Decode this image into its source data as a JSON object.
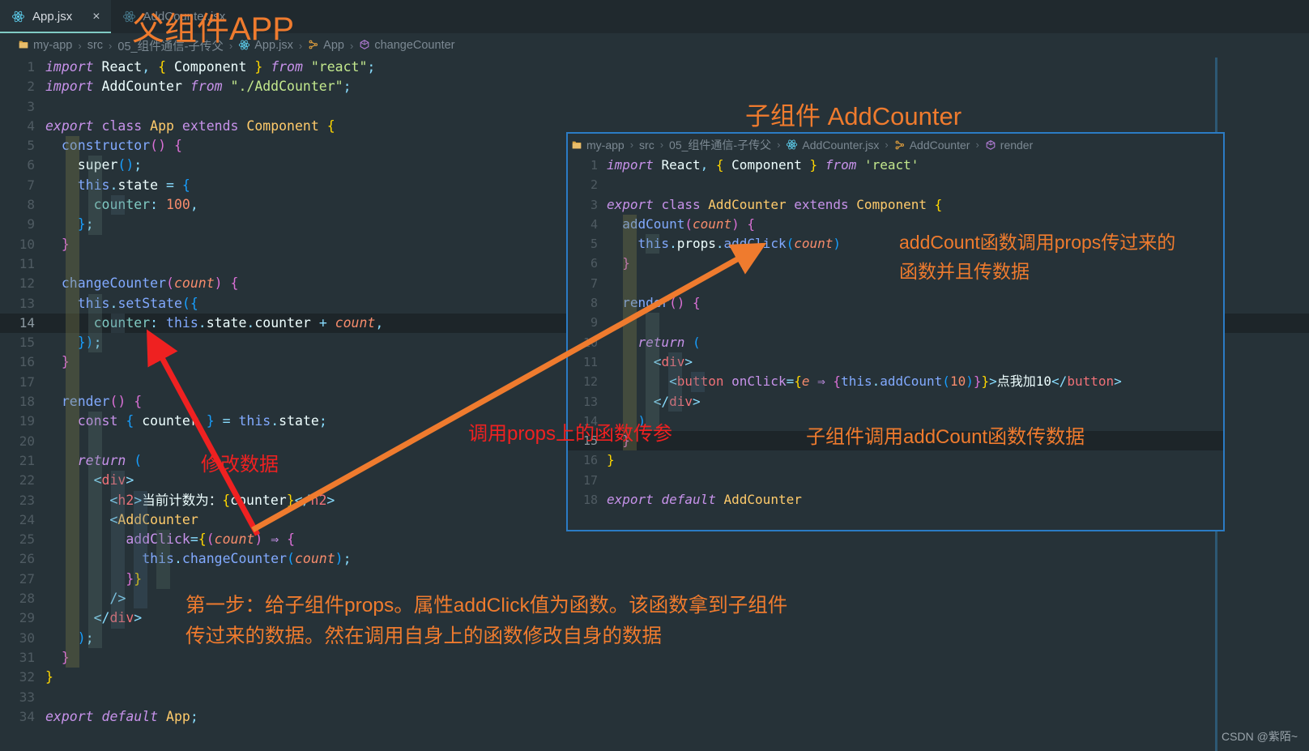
{
  "window": {
    "background": "#263238",
    "accent_teal": "#80cbc4",
    "inset_border": "#2b7bc4",
    "annotation_orange": "#ef7b2e",
    "annotation_red": "#ef2121"
  },
  "tabs": [
    {
      "label": "App.jsx",
      "icon": "react-icon",
      "active": true,
      "close": "×"
    },
    {
      "label": "AddCounter.jsx",
      "icon": "react-icon",
      "active": false,
      "close": ""
    }
  ],
  "breadcrumb": {
    "items": [
      {
        "label": "my-app",
        "icon": "folder-icon"
      },
      {
        "label": "src",
        "icon": ""
      },
      {
        "label": "05_组件通信-子传父",
        "icon": ""
      },
      {
        "label": "App.jsx",
        "icon": "react-icon"
      },
      {
        "label": "App",
        "icon": "class-icon"
      },
      {
        "label": "changeCounter",
        "icon": "method-icon"
      }
    ],
    "separator": "›"
  },
  "main_editor": {
    "lines": [
      {
        "n": 1,
        "guides": 0,
        "html": "<span class=\"kw\">import</span> <span class=\"plain\">React</span><span class=\"punc\">,</span> <span class=\"brkt1\">{</span> <span class=\"plain\">Component</span> <span class=\"brkt1\">}</span> <span class=\"kw\">from</span> <span class=\"str\">\"react\"</span><span class=\"punc\">;</span>"
      },
      {
        "n": 2,
        "guides": 0,
        "html": "<span class=\"kw\">import</span> <span class=\"plain\">AddCounter</span> <span class=\"kw\">from</span> <span class=\"str\">\"./AddCounter\"</span><span class=\"punc\">;</span>"
      },
      {
        "n": 3,
        "guides": 0,
        "html": ""
      },
      {
        "n": 4,
        "guides": 0,
        "html": "<span class=\"kw\">export</span> <span class=\"kw2\">class</span> <span class=\"cls\">App</span> <span class=\"kw2\">extends</span> <span class=\"cls\">Component</span> <span class=\"brkt1\">{</span>"
      },
      {
        "n": 5,
        "guides": 1,
        "html": "  <span class=\"fn\">constructor</span><span class=\"brkt2\">()</span> <span class=\"brkt2\">{</span>"
      },
      {
        "n": 6,
        "guides": 2,
        "html": "    <span class=\"plain\">super</span><span class=\"brkt3\">()</span><span class=\"punc\">;</span>"
      },
      {
        "n": 7,
        "guides": 2,
        "html": "    <span class=\"var\">this</span><span class=\"punc\">.</span><span class=\"plain\">state</span> <span class=\"op\">=</span> <span class=\"brkt3\">{</span>"
      },
      {
        "n": 8,
        "guides": 3,
        "html": "      <span class=\"prop\">counter</span><span class=\"punc\">:</span> <span class=\"num\">100</span><span class=\"punc\">,</span>"
      },
      {
        "n": 9,
        "guides": 2,
        "html": "    <span class=\"brkt3\">}</span><span class=\"punc\">;</span>"
      },
      {
        "n": 10,
        "guides": 1,
        "html": "  <span class=\"brkt2\">}</span>"
      },
      {
        "n": 11,
        "guides": 1,
        "html": ""
      },
      {
        "n": 12,
        "guides": 1,
        "html": "  <span class=\"fn\">changeCounter</span><span class=\"brkt2\">(</span><span class=\"param\">count</span><span class=\"brkt2\">)</span> <span class=\"brkt2\">{</span>"
      },
      {
        "n": 13,
        "guides": 2,
        "html": "    <span class=\"var\">this</span><span class=\"punc\">.</span><span class=\"fn\">setState</span><span class=\"brkt3\">({</span>"
      },
      {
        "n": 14,
        "guides": 3,
        "cursor": true,
        "html": "      <span class=\"prop\">counter</span><span class=\"punc\">:</span> <span class=\"var\">this</span><span class=\"punc\">.</span><span class=\"plain\">state</span><span class=\"punc\">.</span><span class=\"plain\">counter</span> <span class=\"op\">+</span> <span class=\"param\">count</span><span class=\"punc\">,</span>"
      },
      {
        "n": 15,
        "guides": 2,
        "html": "    <span class=\"brkt3\">})</span><span class=\"punc\">;</span>"
      },
      {
        "n": 16,
        "guides": 1,
        "html": "  <span class=\"brkt2\">}</span>"
      },
      {
        "n": 17,
        "guides": 1,
        "html": ""
      },
      {
        "n": 18,
        "guides": 1,
        "html": "  <span class=\"fn\">render</span><span class=\"brkt2\">()</span> <span class=\"brkt2\">{</span>"
      },
      {
        "n": 19,
        "guides": 2,
        "html": "    <span class=\"kw2\">const</span> <span class=\"brkt3\">{</span> <span class=\"plain\">counter</span> <span class=\"brkt3\">}</span> <span class=\"op\">=</span> <span class=\"var\">this</span><span class=\"punc\">.</span><span class=\"plain\">state</span><span class=\"punc\">;</span>"
      },
      {
        "n": 20,
        "guides": 2,
        "html": ""
      },
      {
        "n": 21,
        "guides": 2,
        "html": "    <span class=\"kw\">return</span> <span class=\"brkt3\">(</span>"
      },
      {
        "n": 22,
        "guides": 3,
        "html": "      <span class=\"punc\">&lt;</span><span class=\"tag\">div</span><span class=\"punc\">&gt;</span>"
      },
      {
        "n": 23,
        "guides": 4,
        "html": "        <span class=\"punc\">&lt;</span><span class=\"tag\">h2</span><span class=\"punc\">&gt;</span><span class=\"txt\">当前计数为：</span><span class=\"brkt1\">{</span><span class=\"plain\">counter</span><span class=\"brkt1\">}</span><span class=\"punc\">&lt;/</span><span class=\"tag\">h2</span><span class=\"punc\">&gt;</span>"
      },
      {
        "n": 24,
        "guides": 4,
        "html": "        <span class=\"punc\">&lt;</span><span class=\"cls\">AddCounter</span>"
      },
      {
        "n": 25,
        "guides": 5,
        "html": "          <span class=\"attr\">addClick</span><span class=\"op\">=</span><span class=\"brkt1\">{</span><span class=\"brkt2\">(</span><span class=\"param\">count</span><span class=\"brkt2\">)</span> <span class=\"arrow\">⇒</span> <span class=\"brkt2\">{</span>"
      },
      {
        "n": 26,
        "guides": 5,
        "html": "            <span class=\"var\">this</span><span class=\"punc\">.</span><span class=\"fn\">changeCounter</span><span class=\"brkt3\">(</span><span class=\"param\">count</span><span class=\"brkt3\">)</span><span class=\"punc\">;</span>"
      },
      {
        "n": 27,
        "guides": 5,
        "html": "          <span class=\"brkt2\">}</span><span class=\"brkt1\">}</span>"
      },
      {
        "n": 28,
        "guides": 4,
        "html": "        <span class=\"punc\">/&gt;</span>"
      },
      {
        "n": 29,
        "guides": 3,
        "html": "      <span class=\"punc\">&lt;/</span><span class=\"tag\">div</span><span class=\"punc\">&gt;</span>"
      },
      {
        "n": 30,
        "guides": 2,
        "html": "    <span class=\"brkt3\">)</span><span class=\"punc\">;</span>"
      },
      {
        "n": 31,
        "guides": 1,
        "html": "  <span class=\"brkt2\">}</span>"
      },
      {
        "n": 32,
        "guides": 0,
        "html": "<span class=\"brkt1\">}</span>"
      },
      {
        "n": 33,
        "guides": 0,
        "html": ""
      },
      {
        "n": 34,
        "guides": 0,
        "html": "<span class=\"kw\">export</span> <span class=\"kw\">default</span> <span class=\"cls\">App</span><span class=\"punc\">;</span>"
      }
    ]
  },
  "inset_editor": {
    "breadcrumb": {
      "items": [
        {
          "label": "my-app",
          "icon": "folder-icon"
        },
        {
          "label": "src",
          "icon": ""
        },
        {
          "label": "05_组件通信-子传父",
          "icon": ""
        },
        {
          "label": "AddCounter.jsx",
          "icon": "react-icon"
        },
        {
          "label": "AddCounter",
          "icon": "class-icon"
        },
        {
          "label": "render",
          "icon": "method-icon"
        }
      ],
      "separator": "›"
    },
    "lines": [
      {
        "n": 1,
        "guides": 0,
        "html": "<span class=\"kw\">import</span> <span class=\"plain\">React</span><span class=\"punc\">,</span> <span class=\"brkt1\">{</span> <span class=\"plain\">Component</span> <span class=\"brkt1\">}</span> <span class=\"kw\">from</span> <span class=\"str\">'react'</span>"
      },
      {
        "n": 2,
        "guides": 0,
        "html": ""
      },
      {
        "n": 3,
        "guides": 0,
        "html": "<span class=\"kw\">export</span> <span class=\"kw2\">class</span> <span class=\"cls\">AddCounter</span> <span class=\"kw2\">extends</span> <span class=\"cls\">Component</span> <span class=\"brkt1\">{</span>"
      },
      {
        "n": 4,
        "guides": 1,
        "html": "  <span class=\"fn\">addCount</span><span class=\"brkt2\">(</span><span class=\"param\">count</span><span class=\"brkt2\">)</span> <span class=\"brkt2\">{</span>"
      },
      {
        "n": 5,
        "guides": 2,
        "html": "    <span class=\"var\">this</span><span class=\"punc\">.</span><span class=\"plain\">props</span><span class=\"punc\">.</span><span class=\"fn\">addClick</span><span class=\"brkt3\">(</span><span class=\"param\">count</span><span class=\"brkt3\">)</span>"
      },
      {
        "n": 6,
        "guides": 1,
        "html": "  <span class=\"brkt2\">}</span>"
      },
      {
        "n": 7,
        "guides": 1,
        "html": ""
      },
      {
        "n": 8,
        "guides": 1,
        "html": "  <span class=\"fn\">render</span><span class=\"brkt2\">()</span> <span class=\"brkt2\">{</span>"
      },
      {
        "n": 9,
        "guides": 2,
        "html": ""
      },
      {
        "n": 10,
        "guides": 2,
        "html": "    <span class=\"kw\">return</span> <span class=\"brkt3\">(</span>"
      },
      {
        "n": 11,
        "guides": 3,
        "html": "      <span class=\"punc\">&lt;</span><span class=\"tag\">div</span><span class=\"punc\">&gt;</span>"
      },
      {
        "n": 12,
        "guides": 4,
        "html": "        <span class=\"punc\">&lt;</span><span class=\"tag\">button</span> <span class=\"attr\">onClick</span><span class=\"op\">=</span><span class=\"brkt1\">{</span><span class=\"param\">e</span> <span class=\"arrow\">⇒</span> <span class=\"brkt2\">{</span><span class=\"var\">this</span><span class=\"punc\">.</span><span class=\"fn\">addCount</span><span class=\"brkt3\">(</span><span class=\"num\">10</span><span class=\"brkt3\">)</span><span class=\"brkt2\">}</span><span class=\"brkt1\">}</span><span class=\"punc\">&gt;</span><span class=\"txt\">点我加</span><span class=\"plain\">10</span><span class=\"punc\">&lt;/</span><span class=\"tag\">button</span><span class=\"punc\">&gt;</span>"
      },
      {
        "n": 13,
        "guides": 3,
        "html": "      <span class=\"punc\">&lt;/</span><span class=\"tag\">div</span><span class=\"punc\">&gt;</span>"
      },
      {
        "n": 14,
        "guides": 2,
        "html": "    <span class=\"brkt3\">)</span>"
      },
      {
        "n": 15,
        "guides": 1,
        "cursor": true,
        "html": "  <span class=\"brkt2\">}</span>"
      },
      {
        "n": 16,
        "guides": 0,
        "html": "<span class=\"brkt1\">}</span>"
      },
      {
        "n": 17,
        "guides": 0,
        "html": ""
      },
      {
        "n": 18,
        "guides": 0,
        "html": "<span class=\"kw\">export</span> <span class=\"kw\">default</span> <span class=\"cls\">AddCounter</span>"
      }
    ]
  },
  "annotations": {
    "title_parent": "父组件APP",
    "title_child": "子组件 AddCounter",
    "right_note": "addCount函数调用props传过来的\n函数并且传数据",
    "bottom_note": "第一步：给子组件props。属性addClick值为函数。该函数拿到子组件\n传过来的数据。然在调用自身上的函数修改自身的数据",
    "mid_red_note": "调用props上的函数传参",
    "modify_red_note": "修改数据",
    "sub_orange_note": "子组件调用addCount函数传数据"
  },
  "watermark": "CSDN @紫陌~"
}
